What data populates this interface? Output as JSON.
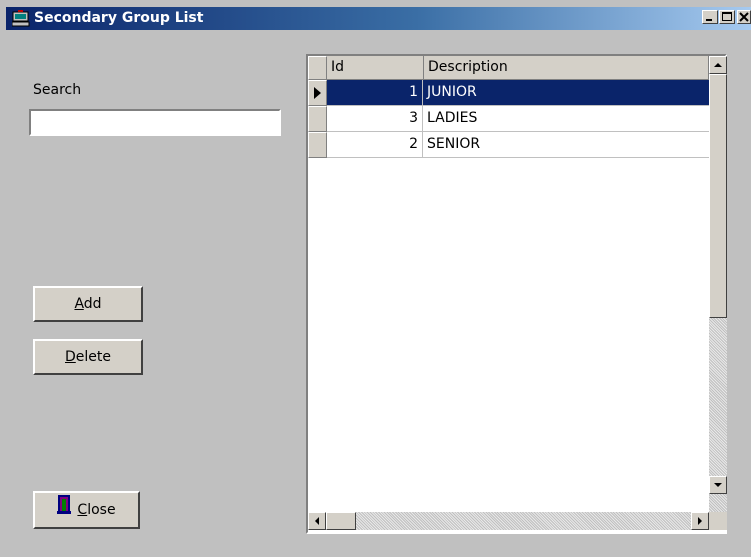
{
  "window": {
    "title": "Secondary Group List"
  },
  "search": {
    "label": "Search",
    "value": ""
  },
  "buttons": {
    "add": {
      "accel": "A",
      "rest": "dd"
    },
    "delete": {
      "accel": "D",
      "rest": "elete"
    },
    "close": {
      "accel": "C",
      "rest": "lose"
    }
  },
  "grid": {
    "columns": [
      "Id",
      "Description"
    ],
    "rows": [
      {
        "id": "1",
        "description": "JUNIOR",
        "selected": true
      },
      {
        "id": "3",
        "description": "LADIES",
        "selected": false
      },
      {
        "id": "2",
        "description": "SENIOR",
        "selected": false
      }
    ]
  },
  "colors": {
    "selection": "#0a246a",
    "title_start": "#0a246a",
    "title_end": "#a6caf0",
    "face": "#d4d0c8"
  }
}
